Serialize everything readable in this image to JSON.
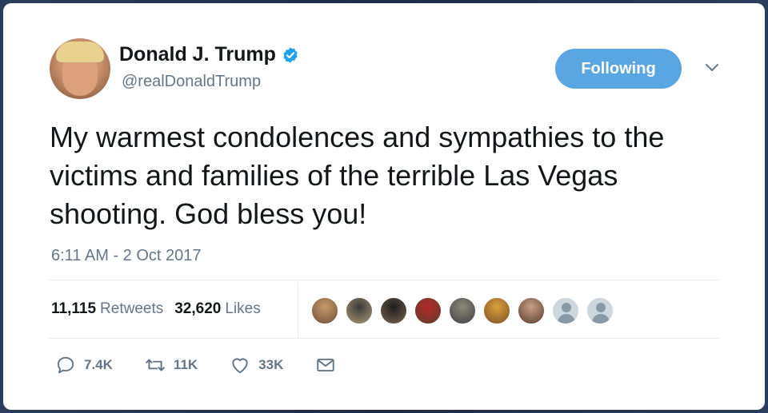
{
  "author": {
    "name": "Donald J. Trump",
    "handle": "@realDonaldTrump",
    "verified": true
  },
  "follow_button": {
    "label": "Following"
  },
  "tweet": {
    "text": "My warmest condolences and sympathies to the victims and families of the terrible Las Vegas shooting. God bless you!",
    "timestamp": "6:11 AM - 2 Oct 2017"
  },
  "stats": {
    "retweets_count": "11,115",
    "retweets_label": "Retweets",
    "likes_count": "32,620",
    "likes_label": "Likes"
  },
  "actions": {
    "replies": "7.4K",
    "retweets": "11K",
    "likes": "33K"
  },
  "colors": {
    "accent": "#5aa6e2",
    "secondary_text": "#657786",
    "primary_text": "#14171a"
  },
  "likers": [
    {
      "color_a": "#c89a6a",
      "color_b": "#7a5a3e"
    },
    {
      "color_a": "#3b3b3b",
      "color_b": "#9a8a6e"
    },
    {
      "color_a": "#1e1e1e",
      "color_b": "#6b5a4a"
    },
    {
      "color_a": "#b42a2a",
      "color_b": "#6a3a2a"
    },
    {
      "color_a": "#8e8a7a",
      "color_b": "#4a4a4a"
    },
    {
      "color_a": "#d9a23a",
      "color_b": "#8a5a2a"
    },
    {
      "color_a": "#c8a08a",
      "color_b": "#6a4a3a"
    },
    {
      "default": true
    },
    {
      "default": true
    }
  ]
}
